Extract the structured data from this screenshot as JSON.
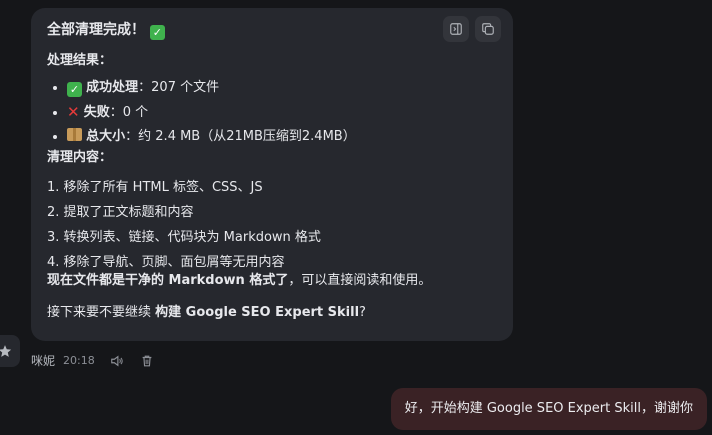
{
  "message": {
    "title": "全部清理完成！",
    "results_heading": "处理结果：",
    "results": [
      {
        "label": "成功处理",
        "value": "：207 个文件"
      },
      {
        "label": "失败",
        "value": "：0 个"
      },
      {
        "label": "总大小",
        "value": "：约 2.4 MB（从21MB压缩到2.4MB）"
      }
    ],
    "content_heading": "清理内容：",
    "steps": [
      "1. 移除了所有 HTML 标签、CSS、JS",
      "2. 提取了正文标题和内容",
      "3. 转换列表、链接、代码块为 Markdown 格式",
      "4. 移除了导航、页脚、面包屑等无用内容"
    ],
    "summary_bold": "现在文件都是干净的 Markdown 格式了",
    "summary_rest": "，可以直接阅读和使用。",
    "followup_prefix": "接下来要不要继续 ",
    "followup_bold": "构建 Google SEO Expert Skill",
    "followup_suffix": "?"
  },
  "meta": {
    "sender": "咪妮",
    "time": "20:18"
  },
  "user_message": "好，开始构建 Google SEO Expert Skill，谢谢你",
  "icons": {
    "title_emoji": "check-mark-icon",
    "success": "check-mark-icon",
    "fail": "cross-mark-icon",
    "size": "package-icon",
    "action1": "panel-icon",
    "action2": "copy-icon",
    "speak": "speaker-icon",
    "delete": "trash-icon",
    "star": "star-icon"
  },
  "colors": {
    "bg": "#151619",
    "bubble": "#26282e",
    "user_bubble": "#3a2225",
    "check": "#3fb24d",
    "cross": "#e53a3a"
  }
}
